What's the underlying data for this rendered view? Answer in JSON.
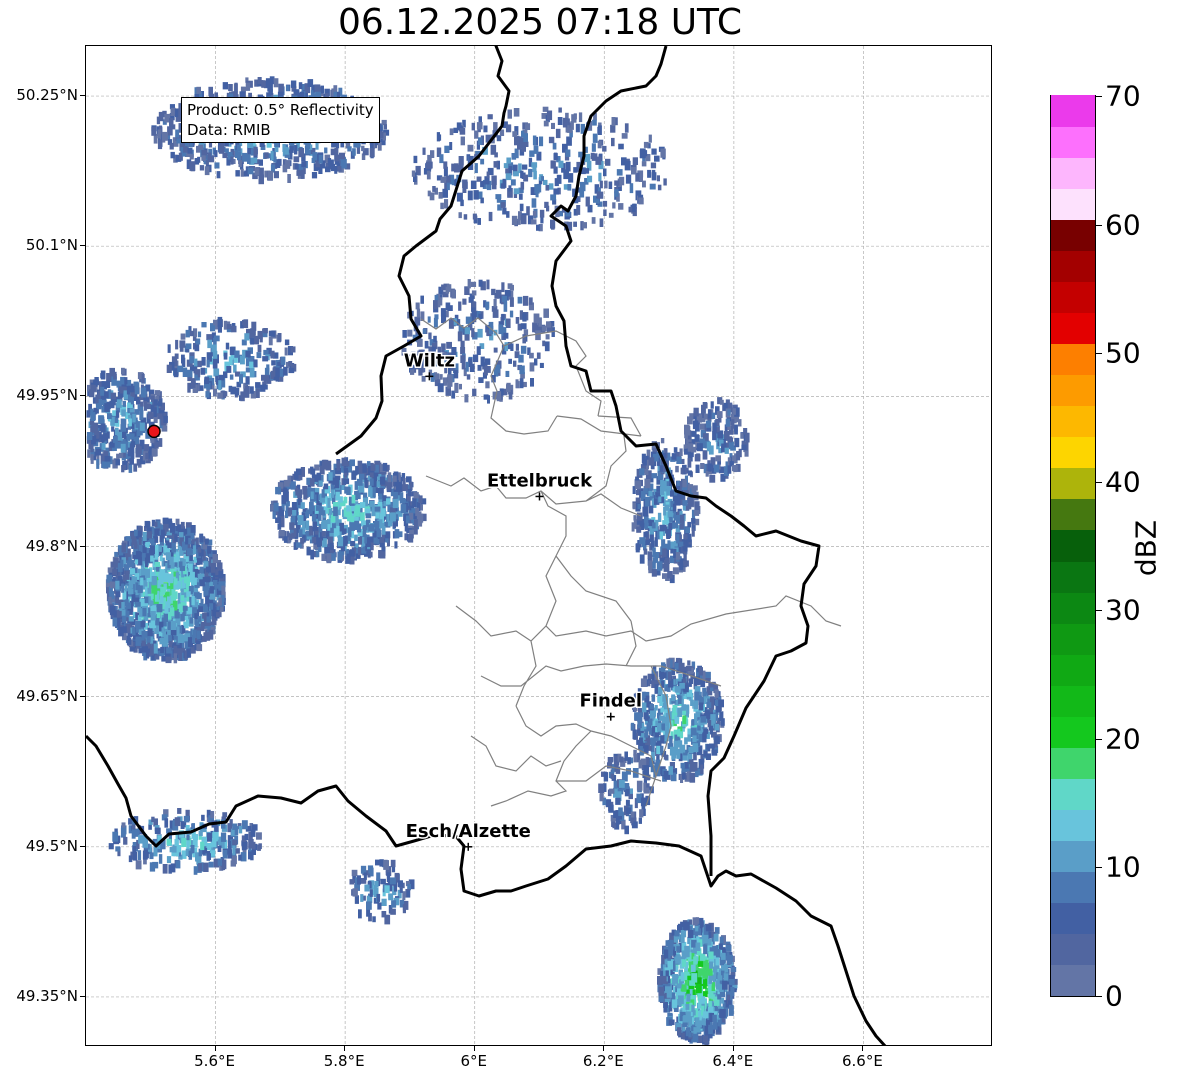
{
  "title": "06.12.2025 07:18 UTC",
  "info": {
    "product": "Product: 0.5° Reflectivity",
    "data_source": "Data: RMIB"
  },
  "map": {
    "lon_range": [
      5.4,
      6.8
    ],
    "lat_range": [
      49.3,
      50.3
    ],
    "lat_ticks": [
      {
        "value": 50.25,
        "label": "50.25°N"
      },
      {
        "value": 50.1,
        "label": "50.1°N"
      },
      {
        "value": 49.95,
        "label": "49.95°N"
      },
      {
        "value": 49.8,
        "label": "49.8°N"
      },
      {
        "value": 49.65,
        "label": "49.65°N"
      },
      {
        "value": 49.5,
        "label": "49.5°N"
      },
      {
        "value": 49.35,
        "label": "49.35°N"
      }
    ],
    "lon_ticks": [
      {
        "value": 5.6,
        "label": "5.6°E"
      },
      {
        "value": 5.8,
        "label": "5.8°E"
      },
      {
        "value": 6.0,
        "label": "6°E"
      },
      {
        "value": 6.2,
        "label": "6.2°E"
      },
      {
        "value": 6.4,
        "label": "6.4°E"
      },
      {
        "value": 6.6,
        "label": "6.6°E"
      }
    ],
    "cities": [
      {
        "name": "Wiltz",
        "lon": 5.93,
        "lat": 49.97
      },
      {
        "name": "Ettelbruck",
        "lon": 6.1,
        "lat": 49.85
      },
      {
        "name": "Findel",
        "lon": 6.21,
        "lat": 49.63
      },
      {
        "name": "Esch/Alzette",
        "lon": 5.99,
        "lat": 49.5
      }
    ],
    "radar_site": {
      "lon": 5.505,
      "lat": 49.915,
      "color": "#e8141a"
    },
    "border_color": "#000000",
    "district_color": "#808080"
  },
  "colorbar": {
    "label": "dBZ",
    "min": 0,
    "max": 70,
    "ticks": [
      0,
      10,
      20,
      30,
      40,
      50,
      60,
      70
    ],
    "colors": [
      "#6375a6",
      "#5166a0",
      "#4260a3",
      "#4b78b2",
      "#5a9ec8",
      "#68c4dc",
      "#60d7c8",
      "#3fd56c",
      "#14c81e",
      "#12b918",
      "#10a914",
      "#0f9913",
      "#0c8813",
      "#0a7612",
      "#07600b",
      "#457810",
      "#adb40b",
      "#fdd500",
      "#fdb800",
      "#fd9b00",
      "#fd7f00",
      "#e30000",
      "#c40000",
      "#a30000",
      "#780000",
      "#fde1fd",
      "#fdb6fd",
      "#fd70fd",
      "#eb3aeb"
    ]
  },
  "precip_cells": [
    {
      "lon": 5.52,
      "lat": 49.76,
      "rlon": 0.09,
      "rlat": 0.07,
      "dbz": 12,
      "density": 0.55
    },
    {
      "lon": 5.45,
      "lat": 49.93,
      "rlon": 0.07,
      "rlat": 0.05,
      "dbz": 8,
      "density": 0.35
    },
    {
      "lon": 5.8,
      "lat": 49.84,
      "rlon": 0.12,
      "rlat": 0.05,
      "dbz": 10,
      "density": 0.35
    },
    {
      "lon": 5.62,
      "lat": 49.99,
      "rlon": 0.1,
      "rlat": 0.04,
      "dbz": 8,
      "density": 0.18
    },
    {
      "lon": 5.68,
      "lat": 50.22,
      "rlon": 0.18,
      "rlat": 0.05,
      "dbz": 8,
      "density": 0.22
    },
    {
      "lon": 6.29,
      "lat": 49.84,
      "rlon": 0.05,
      "rlat": 0.07,
      "dbz": 8,
      "density": 0.3
    },
    {
      "lon": 6.31,
      "lat": 49.63,
      "rlon": 0.07,
      "rlat": 0.06,
      "dbz": 11,
      "density": 0.35
    },
    {
      "lon": 6.37,
      "lat": 49.91,
      "rlon": 0.05,
      "rlat": 0.04,
      "dbz": 6,
      "density": 0.25
    },
    {
      "lon": 6.34,
      "lat": 49.37,
      "rlon": 0.06,
      "rlat": 0.06,
      "dbz": 15,
      "density": 0.55
    },
    {
      "lon": 5.85,
      "lat": 49.46,
      "rlon": 0.05,
      "rlat": 0.03,
      "dbz": 8,
      "density": 0.18
    },
    {
      "lon": 5.55,
      "lat": 49.51,
      "rlon": 0.12,
      "rlat": 0.03,
      "dbz": 10,
      "density": 0.2
    },
    {
      "lon": 6.0,
      "lat": 50.01,
      "rlon": 0.12,
      "rlat": 0.06,
      "dbz": 6,
      "density": 0.12
    },
    {
      "lon": 6.1,
      "lat": 50.18,
      "rlon": 0.2,
      "rlat": 0.06,
      "dbz": 6,
      "density": 0.1
    },
    {
      "lon": 6.23,
      "lat": 49.56,
      "rlon": 0.04,
      "rlat": 0.04,
      "dbz": 6,
      "density": 0.2
    }
  ]
}
